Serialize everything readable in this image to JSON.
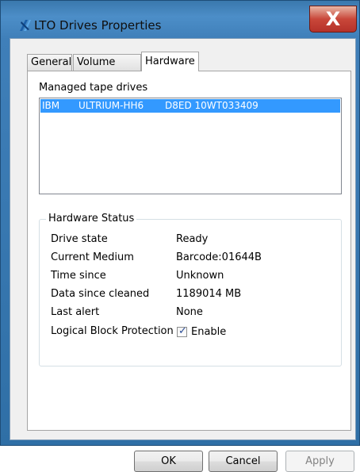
{
  "window": {
    "title": "LTO Drives Properties",
    "close_symbol": "X"
  },
  "tabs": [
    {
      "label": "General"
    },
    {
      "label": "Volume Sets"
    },
    {
      "label": "Hardware"
    }
  ],
  "hardware": {
    "drives_label": "Managed tape drives",
    "drives": [
      {
        "vendor": "IBM",
        "model": "ULTRIUM-HH6",
        "serial": "D8ED 10WT033409"
      }
    ],
    "status": {
      "title": "Hardware Status",
      "rows": [
        {
          "label": "Drive state",
          "value": "Ready"
        },
        {
          "label": "Current Medium",
          "value": "Barcode:01644B"
        },
        {
          "label": "Time since",
          "value": "Unknown"
        },
        {
          "label": "Data since cleaned",
          "value": "1189014 MB"
        },
        {
          "label": "Last alert",
          "value": "None"
        },
        {
          "label": "Logical Block Protection",
          "value": "Enable",
          "checked": true
        }
      ]
    }
  },
  "buttons": {
    "ok": "OK",
    "cancel": "Cancel",
    "apply": "Apply"
  },
  "colors": {
    "selection": "#3399ff",
    "title_bar": "#4c8ec8",
    "close_button": "#c9473a"
  }
}
